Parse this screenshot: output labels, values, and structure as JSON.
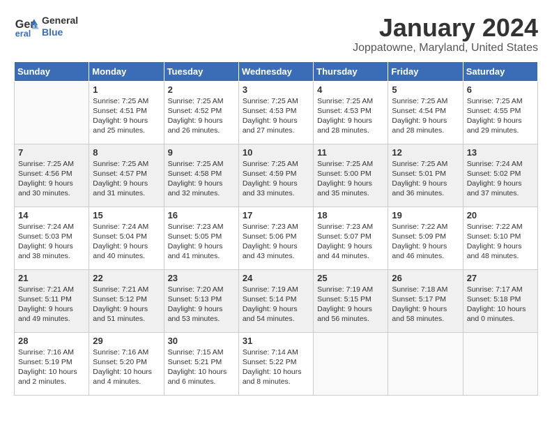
{
  "header": {
    "logo_line1": "General",
    "logo_line2": "Blue",
    "title": "January 2024",
    "location": "Joppatowne, Maryland, United States"
  },
  "weekdays": [
    "Sunday",
    "Monday",
    "Tuesday",
    "Wednesday",
    "Thursday",
    "Friday",
    "Saturday"
  ],
  "weeks": [
    [
      {
        "day": "",
        "info": ""
      },
      {
        "day": "1",
        "info": "Sunrise: 7:25 AM\nSunset: 4:51 PM\nDaylight: 9 hours\nand 25 minutes."
      },
      {
        "day": "2",
        "info": "Sunrise: 7:25 AM\nSunset: 4:52 PM\nDaylight: 9 hours\nand 26 minutes."
      },
      {
        "day": "3",
        "info": "Sunrise: 7:25 AM\nSunset: 4:53 PM\nDaylight: 9 hours\nand 27 minutes."
      },
      {
        "day": "4",
        "info": "Sunrise: 7:25 AM\nSunset: 4:53 PM\nDaylight: 9 hours\nand 28 minutes."
      },
      {
        "day": "5",
        "info": "Sunrise: 7:25 AM\nSunset: 4:54 PM\nDaylight: 9 hours\nand 28 minutes."
      },
      {
        "day": "6",
        "info": "Sunrise: 7:25 AM\nSunset: 4:55 PM\nDaylight: 9 hours\nand 29 minutes."
      }
    ],
    [
      {
        "day": "7",
        "info": "Sunrise: 7:25 AM\nSunset: 4:56 PM\nDaylight: 9 hours\nand 30 minutes."
      },
      {
        "day": "8",
        "info": "Sunrise: 7:25 AM\nSunset: 4:57 PM\nDaylight: 9 hours\nand 31 minutes."
      },
      {
        "day": "9",
        "info": "Sunrise: 7:25 AM\nSunset: 4:58 PM\nDaylight: 9 hours\nand 32 minutes."
      },
      {
        "day": "10",
        "info": "Sunrise: 7:25 AM\nSunset: 4:59 PM\nDaylight: 9 hours\nand 33 minutes."
      },
      {
        "day": "11",
        "info": "Sunrise: 7:25 AM\nSunset: 5:00 PM\nDaylight: 9 hours\nand 35 minutes."
      },
      {
        "day": "12",
        "info": "Sunrise: 7:25 AM\nSunset: 5:01 PM\nDaylight: 9 hours\nand 36 minutes."
      },
      {
        "day": "13",
        "info": "Sunrise: 7:24 AM\nSunset: 5:02 PM\nDaylight: 9 hours\nand 37 minutes."
      }
    ],
    [
      {
        "day": "14",
        "info": "Sunrise: 7:24 AM\nSunset: 5:03 PM\nDaylight: 9 hours\nand 38 minutes."
      },
      {
        "day": "15",
        "info": "Sunrise: 7:24 AM\nSunset: 5:04 PM\nDaylight: 9 hours\nand 40 minutes."
      },
      {
        "day": "16",
        "info": "Sunrise: 7:23 AM\nSunset: 5:05 PM\nDaylight: 9 hours\nand 41 minutes."
      },
      {
        "day": "17",
        "info": "Sunrise: 7:23 AM\nSunset: 5:06 PM\nDaylight: 9 hours\nand 43 minutes."
      },
      {
        "day": "18",
        "info": "Sunrise: 7:23 AM\nSunset: 5:07 PM\nDaylight: 9 hours\nand 44 minutes."
      },
      {
        "day": "19",
        "info": "Sunrise: 7:22 AM\nSunset: 5:09 PM\nDaylight: 9 hours\nand 46 minutes."
      },
      {
        "day": "20",
        "info": "Sunrise: 7:22 AM\nSunset: 5:10 PM\nDaylight: 9 hours\nand 48 minutes."
      }
    ],
    [
      {
        "day": "21",
        "info": "Sunrise: 7:21 AM\nSunset: 5:11 PM\nDaylight: 9 hours\nand 49 minutes."
      },
      {
        "day": "22",
        "info": "Sunrise: 7:21 AM\nSunset: 5:12 PM\nDaylight: 9 hours\nand 51 minutes."
      },
      {
        "day": "23",
        "info": "Sunrise: 7:20 AM\nSunset: 5:13 PM\nDaylight: 9 hours\nand 53 minutes."
      },
      {
        "day": "24",
        "info": "Sunrise: 7:19 AM\nSunset: 5:14 PM\nDaylight: 9 hours\nand 54 minutes."
      },
      {
        "day": "25",
        "info": "Sunrise: 7:19 AM\nSunset: 5:15 PM\nDaylight: 9 hours\nand 56 minutes."
      },
      {
        "day": "26",
        "info": "Sunrise: 7:18 AM\nSunset: 5:17 PM\nDaylight: 9 hours\nand 58 minutes."
      },
      {
        "day": "27",
        "info": "Sunrise: 7:17 AM\nSunset: 5:18 PM\nDaylight: 10 hours\nand 0 minutes."
      }
    ],
    [
      {
        "day": "28",
        "info": "Sunrise: 7:16 AM\nSunset: 5:19 PM\nDaylight: 10 hours\nand 2 minutes."
      },
      {
        "day": "29",
        "info": "Sunrise: 7:16 AM\nSunset: 5:20 PM\nDaylight: 10 hours\nand 4 minutes."
      },
      {
        "day": "30",
        "info": "Sunrise: 7:15 AM\nSunset: 5:21 PM\nDaylight: 10 hours\nand 6 minutes."
      },
      {
        "day": "31",
        "info": "Sunrise: 7:14 AM\nSunset: 5:22 PM\nDaylight: 10 hours\nand 8 minutes."
      },
      {
        "day": "",
        "info": ""
      },
      {
        "day": "",
        "info": ""
      },
      {
        "day": "",
        "info": ""
      }
    ]
  ]
}
